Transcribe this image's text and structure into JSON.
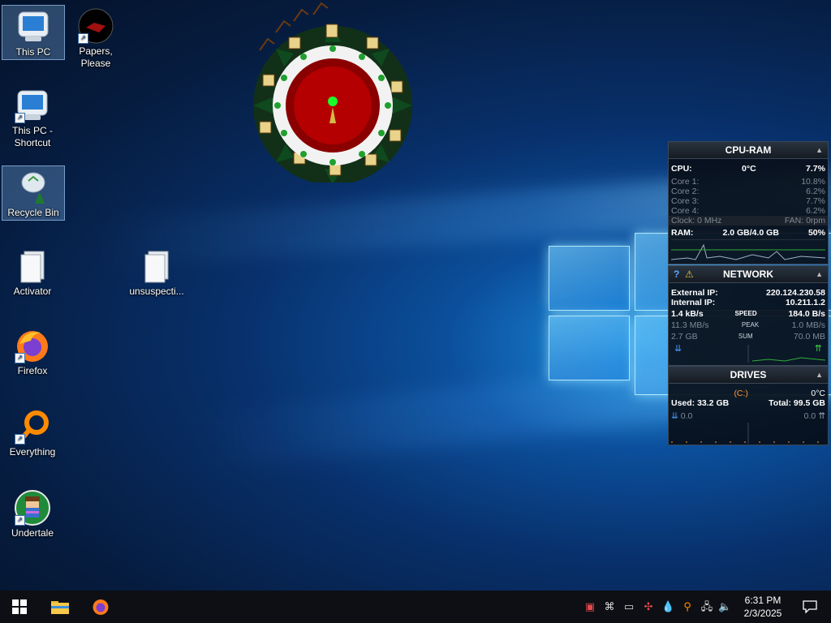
{
  "desktop": {
    "icons": [
      {
        "label": "This PC"
      },
      {
        "label": "Papers, Please"
      },
      {
        "label": "This PC - Shortcut"
      },
      {
        "label": "Recycle Bin"
      },
      {
        "label": "Activator"
      },
      {
        "label": "unsuspecti..."
      },
      {
        "label": "Firefox"
      },
      {
        "label": "Everything"
      },
      {
        "label": "Undertale"
      }
    ]
  },
  "cpu_ram": {
    "title": "CPU-RAM",
    "cpu_label": "CPU:",
    "cpu_temp": "0°C",
    "cpu_usage": "7.7%",
    "cores": [
      {
        "label": "Core 1:",
        "value": "10.8%"
      },
      {
        "label": "Core 2:",
        "value": "6.2%"
      },
      {
        "label": "Core 3:",
        "value": "7.7%"
      },
      {
        "label": "Core 4:",
        "value": "6.2%"
      }
    ],
    "clock": "Clock: 0 MHz",
    "fan": "FAN: 0rpm",
    "ram_label": "RAM:",
    "ram_value": "2.0 GB/4.0 GB",
    "ram_pct": "50%"
  },
  "network": {
    "title": "NETWORK",
    "external_label": "External IP:",
    "external_ip": "220.124.230.58",
    "internal_label": "Internal IP:",
    "internal_ip": "10.211.1.2",
    "rows": [
      {
        "left": "1.4 kB/s",
        "mid": "SPEED",
        "right": "184.0 B/s"
      },
      {
        "left": "11.3 MB/s",
        "mid": "PEAK",
        "right": "1.0 MB/s"
      },
      {
        "left": "2.7 GB",
        "mid": "SUM",
        "right": "70.0 MB"
      }
    ]
  },
  "drives": {
    "title": "DRIVES",
    "drive": "(C:)",
    "temp": "0°C",
    "used": "Used: 33.2 GB",
    "total": "Total: 99.5 GB",
    "read": "0.0",
    "write": "0.0"
  },
  "taskbar": {
    "time": "6:31 PM",
    "date": "2/3/2025"
  }
}
